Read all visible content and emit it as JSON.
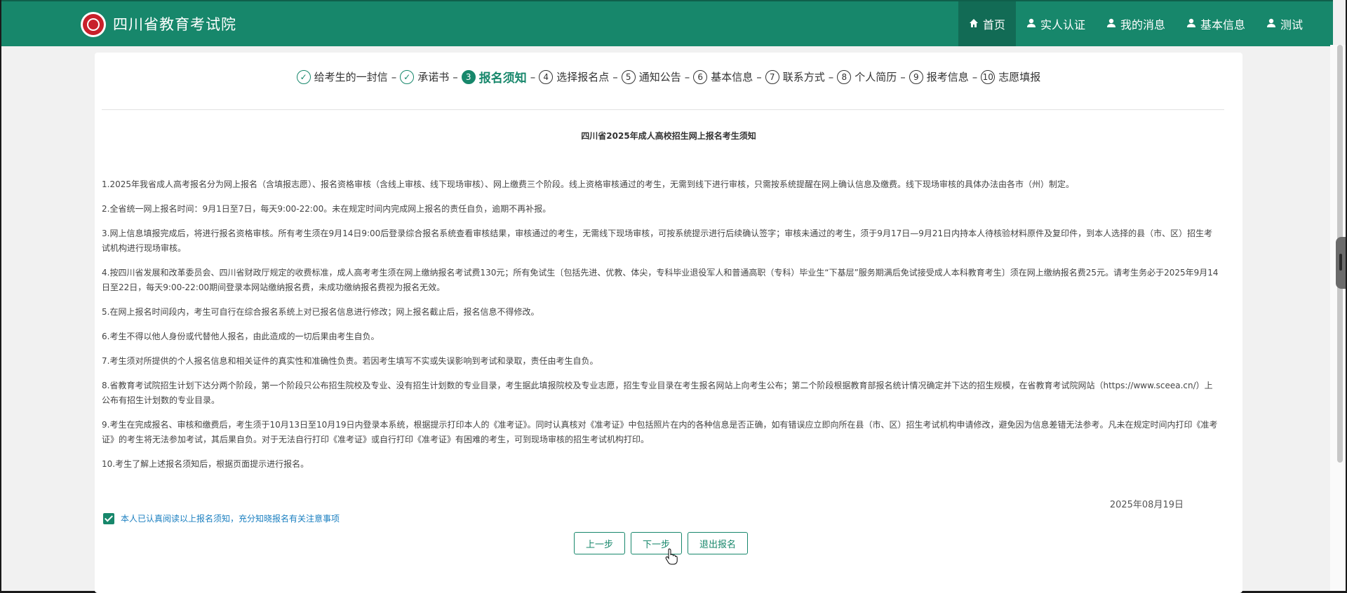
{
  "header": {
    "site_title": "四川省教育考试院",
    "brand_color": "#17876b",
    "logo_icon": "seal-logo-icon",
    "nav": [
      {
        "label": "首页",
        "icon": "home-icon",
        "active": true
      },
      {
        "label": "实人认证",
        "icon": "user-icon"
      },
      {
        "label": "我的消息",
        "icon": "user-icon"
      },
      {
        "label": "基本信息",
        "icon": "user-icon"
      },
      {
        "label": "测试",
        "icon": "user-icon"
      }
    ]
  },
  "steps": [
    {
      "num": "✓",
      "label": "给考生的一封信",
      "state": "done"
    },
    {
      "num": "✓",
      "label": "承诺书",
      "state": "done"
    },
    {
      "num": "3",
      "label": "报名须知",
      "state": "current"
    },
    {
      "num": "4",
      "label": "选择报名点",
      "state": "todo"
    },
    {
      "num": "5",
      "label": "通知公告",
      "state": "todo"
    },
    {
      "num": "6",
      "label": "基本信息",
      "state": "todo"
    },
    {
      "num": "7",
      "label": "联系方式",
      "state": "todo"
    },
    {
      "num": "8",
      "label": "个人简历",
      "state": "todo"
    },
    {
      "num": "9",
      "label": "报考信息",
      "state": "todo"
    },
    {
      "num": "10",
      "label": "志愿填报",
      "state": "todo"
    }
  ],
  "step_separator": "–",
  "notice": {
    "title": "四川省2025年成人高校招生网上报名考生须知",
    "paragraphs": [
      "1.2025年我省成人高考报名分为网上报名（含填报志愿）、报名资格审核（含线上审核、线下现场审核）、网上缴费三个阶段。线上资格审核通过的考生，无需到线下进行审核，只需按系统提醒在网上确认信息及缴费。线下现场审核的具体办法由各市（州）制定。",
      "2.全省统一网上报名时间：9月1日至7日，每天9:00-22:00。未在规定时间内完成网上报名的责任自负，逾期不再补报。",
      "3.网上信息填报完成后，将进行报名资格审核。所有考生须在9月14日9:00后登录综合报名系统查看审核结果，审核通过的考生，无需线下现场审核，可按系统提示进行后续确认签字；审核未通过的考生，须于9月17日—9月21日内持本人待核验材料原件及复印件，到本人选择的县（市、区）招生考试机构进行现场审核。",
      "4.按四川省发展和改革委员会、四川省财政厅规定的收费标准，成人高考考生须在网上缴纳报名考试费130元；所有免试生〔包括先进、优教、体尖，专科毕业退役军人和普通高职（专科）毕业生“下基层”服务期满后免试接受成人本科教育考生〕须在网上缴纳报名费25元。请考生务必于2025年9月14日至22日，每天9:00-22:00期间登录本网站缴纳报名费，未成功缴纳报名费视为报名无效。",
      "5.在网上报名时间段内，考生可自行在综合报名系统上对已报名信息进行修改；网上报名截止后，报名信息不得修改。",
      "6.考生不得以他人身份或代替他人报名，由此造成的一切后果由考生自负。",
      "7.考生须对所提供的个人报名信息和相关证件的真实性和准确性负责。若因考生填写不实或失误影响到考试和录取，责任由考生自负。",
      "8.省教育考试院招生计划下达分两个阶段，第一个阶段只公布招生院校及专业、没有招生计划数的专业目录，考生据此填报院校及专业志愿，招生专业目录在考生报名网站上向考生公布；第二个阶段根据教育部报名统计情况确定并下达的招生规模，在省教育考试院网站（https://www.sceea.cn/）上公布有招生计划数的专业目录。",
      "9.考生在完成报名、审核和缴费后，考生须于10月13日至10月19日内登录本系统，根据提示打印本人的《准考证》。同时认真核对《准考证》中包括照片在内的各种信息是否正确，如有错误应立即向所在县（市、区）招生考试机构申请修改，避免因为信息差错无法参考。凡未在规定时间内打印《准考证》的考生将无法参加考试，其后果自负。对于无法自行打印《准考证》或自行打印《准考证》有困难的考生，可到现场审核的招生考试机构打印。",
      "10.考生了解上述报名须知后，根据页面提示进行报名。"
    ],
    "date": "2025年08月19日"
  },
  "agreement": {
    "checked": true,
    "label": "本人已认真阅读以上报名须知，充分知晓报名有关注意事项"
  },
  "buttons": {
    "prev": "上一步",
    "next": "下一步",
    "exit": "退出报名"
  }
}
